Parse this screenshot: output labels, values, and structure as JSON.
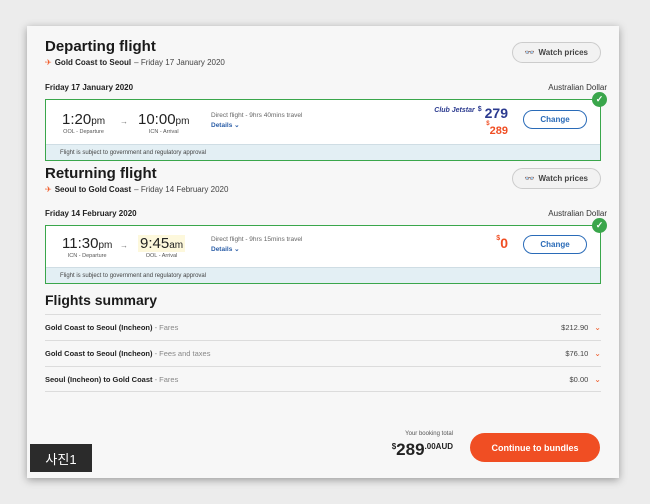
{
  "departing": {
    "title": "Departing flight",
    "route": "Gold Coast to Seoul",
    "date_suffix": " – Friday 17 January 2020",
    "watch_label": "Watch prices",
    "day_label": "Friday 17 January 2020",
    "currency": "Australian Dollar",
    "dep_time": "1:20",
    "dep_ampm": "pm",
    "dep_sub": "OOL - Departure",
    "arr_time": "10:00",
    "arr_ampm": "pm",
    "arr_sub": "ICN - Arrival",
    "info": "Direct flight - 9hrs 40mins travel",
    "details": "Details ⌄",
    "club_label": "Club Jetstar",
    "club_price": "279",
    "price": "289",
    "change_label": "Change",
    "note": "Flight is subject to government and regulatory approval"
  },
  "returning": {
    "title": "Returning flight",
    "route": "Seoul to Gold Coast",
    "date_suffix": " – Friday 14 February 2020",
    "watch_label": "Watch prices",
    "day_label": "Friday 14 February 2020",
    "currency": "Australian Dollar",
    "dep_time": "11:30",
    "dep_ampm": "pm",
    "dep_sub": "ICN - Departure",
    "arr_time": "9:45",
    "arr_ampm": "am",
    "arr_sub": "OOL - Arrival",
    "info": "Direct flight - 9hrs 15mins travel",
    "details": "Details ⌄",
    "price": "0",
    "change_label": "Change",
    "note": "Flight is subject to government and regulatory approval"
  },
  "summary": {
    "title": "Flights summary",
    "rows": [
      {
        "route": "Gold Coast to Seoul (Incheon)",
        "type": " - Fares",
        "amount": "$212.90"
      },
      {
        "route": "Gold Coast to Seoul (Incheon)",
        "type": " - Fees and taxes",
        "amount": "$76.10"
      },
      {
        "route": "Seoul (Incheon) to Gold Coast",
        "type": " - Fares",
        "amount": "$0.00"
      }
    ]
  },
  "footer": {
    "total_label": "Your booking total",
    "dollar": "$",
    "total_main": "289",
    "total_cents": ".00AUD",
    "cta_label": "Continue to bundles"
  },
  "caption": "사진1",
  "colors": {
    "accent": "#f04e23",
    "selected_border": "#3aa64b",
    "link": "#2a6bb8",
    "club_price": "#2b3a8f"
  },
  "icons": {
    "route": "plane-icon",
    "watch": "binoculars-icon",
    "check": "check-icon",
    "chevron": "chevron-down-icon"
  }
}
